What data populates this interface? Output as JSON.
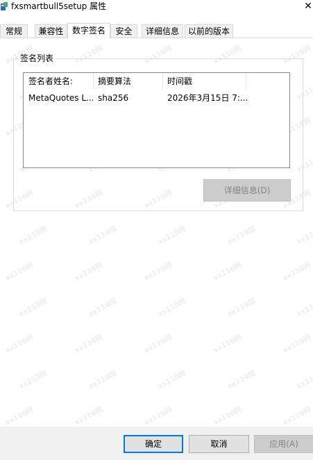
{
  "window": {
    "title": "fxsmartbull5setup 属性",
    "close_glyph": "✕"
  },
  "tabs": [
    {
      "label": "常规"
    },
    {
      "label": "兼容性"
    },
    {
      "label": "数字签名"
    },
    {
      "label": "安全"
    },
    {
      "label": "详细信息"
    },
    {
      "label": "以前的版本"
    }
  ],
  "active_tab": "数字签名",
  "signature_group": {
    "title": "签名列表",
    "columns": [
      "签名者姓名:",
      "摘要算法",
      "时间戳"
    ],
    "rows": [
      {
        "signer": "MetaQuotes L...",
        "digest": "sha256",
        "timestamp": "2026年3月15日 7:..."
      }
    ],
    "details_label": "详细信息(D)"
  },
  "footer": {
    "ok_label": "确定",
    "cancel_label": "取消",
    "apply_label": "应用(A)"
  },
  "watermark_text": "xx110网",
  "colors": {
    "accent": "#0078d7",
    "app_icon_blue": "#1f6fd1",
    "app_icon_green": "#3cb371"
  },
  "icons": {
    "app": "installer-app-icon",
    "close": "close-icon"
  }
}
